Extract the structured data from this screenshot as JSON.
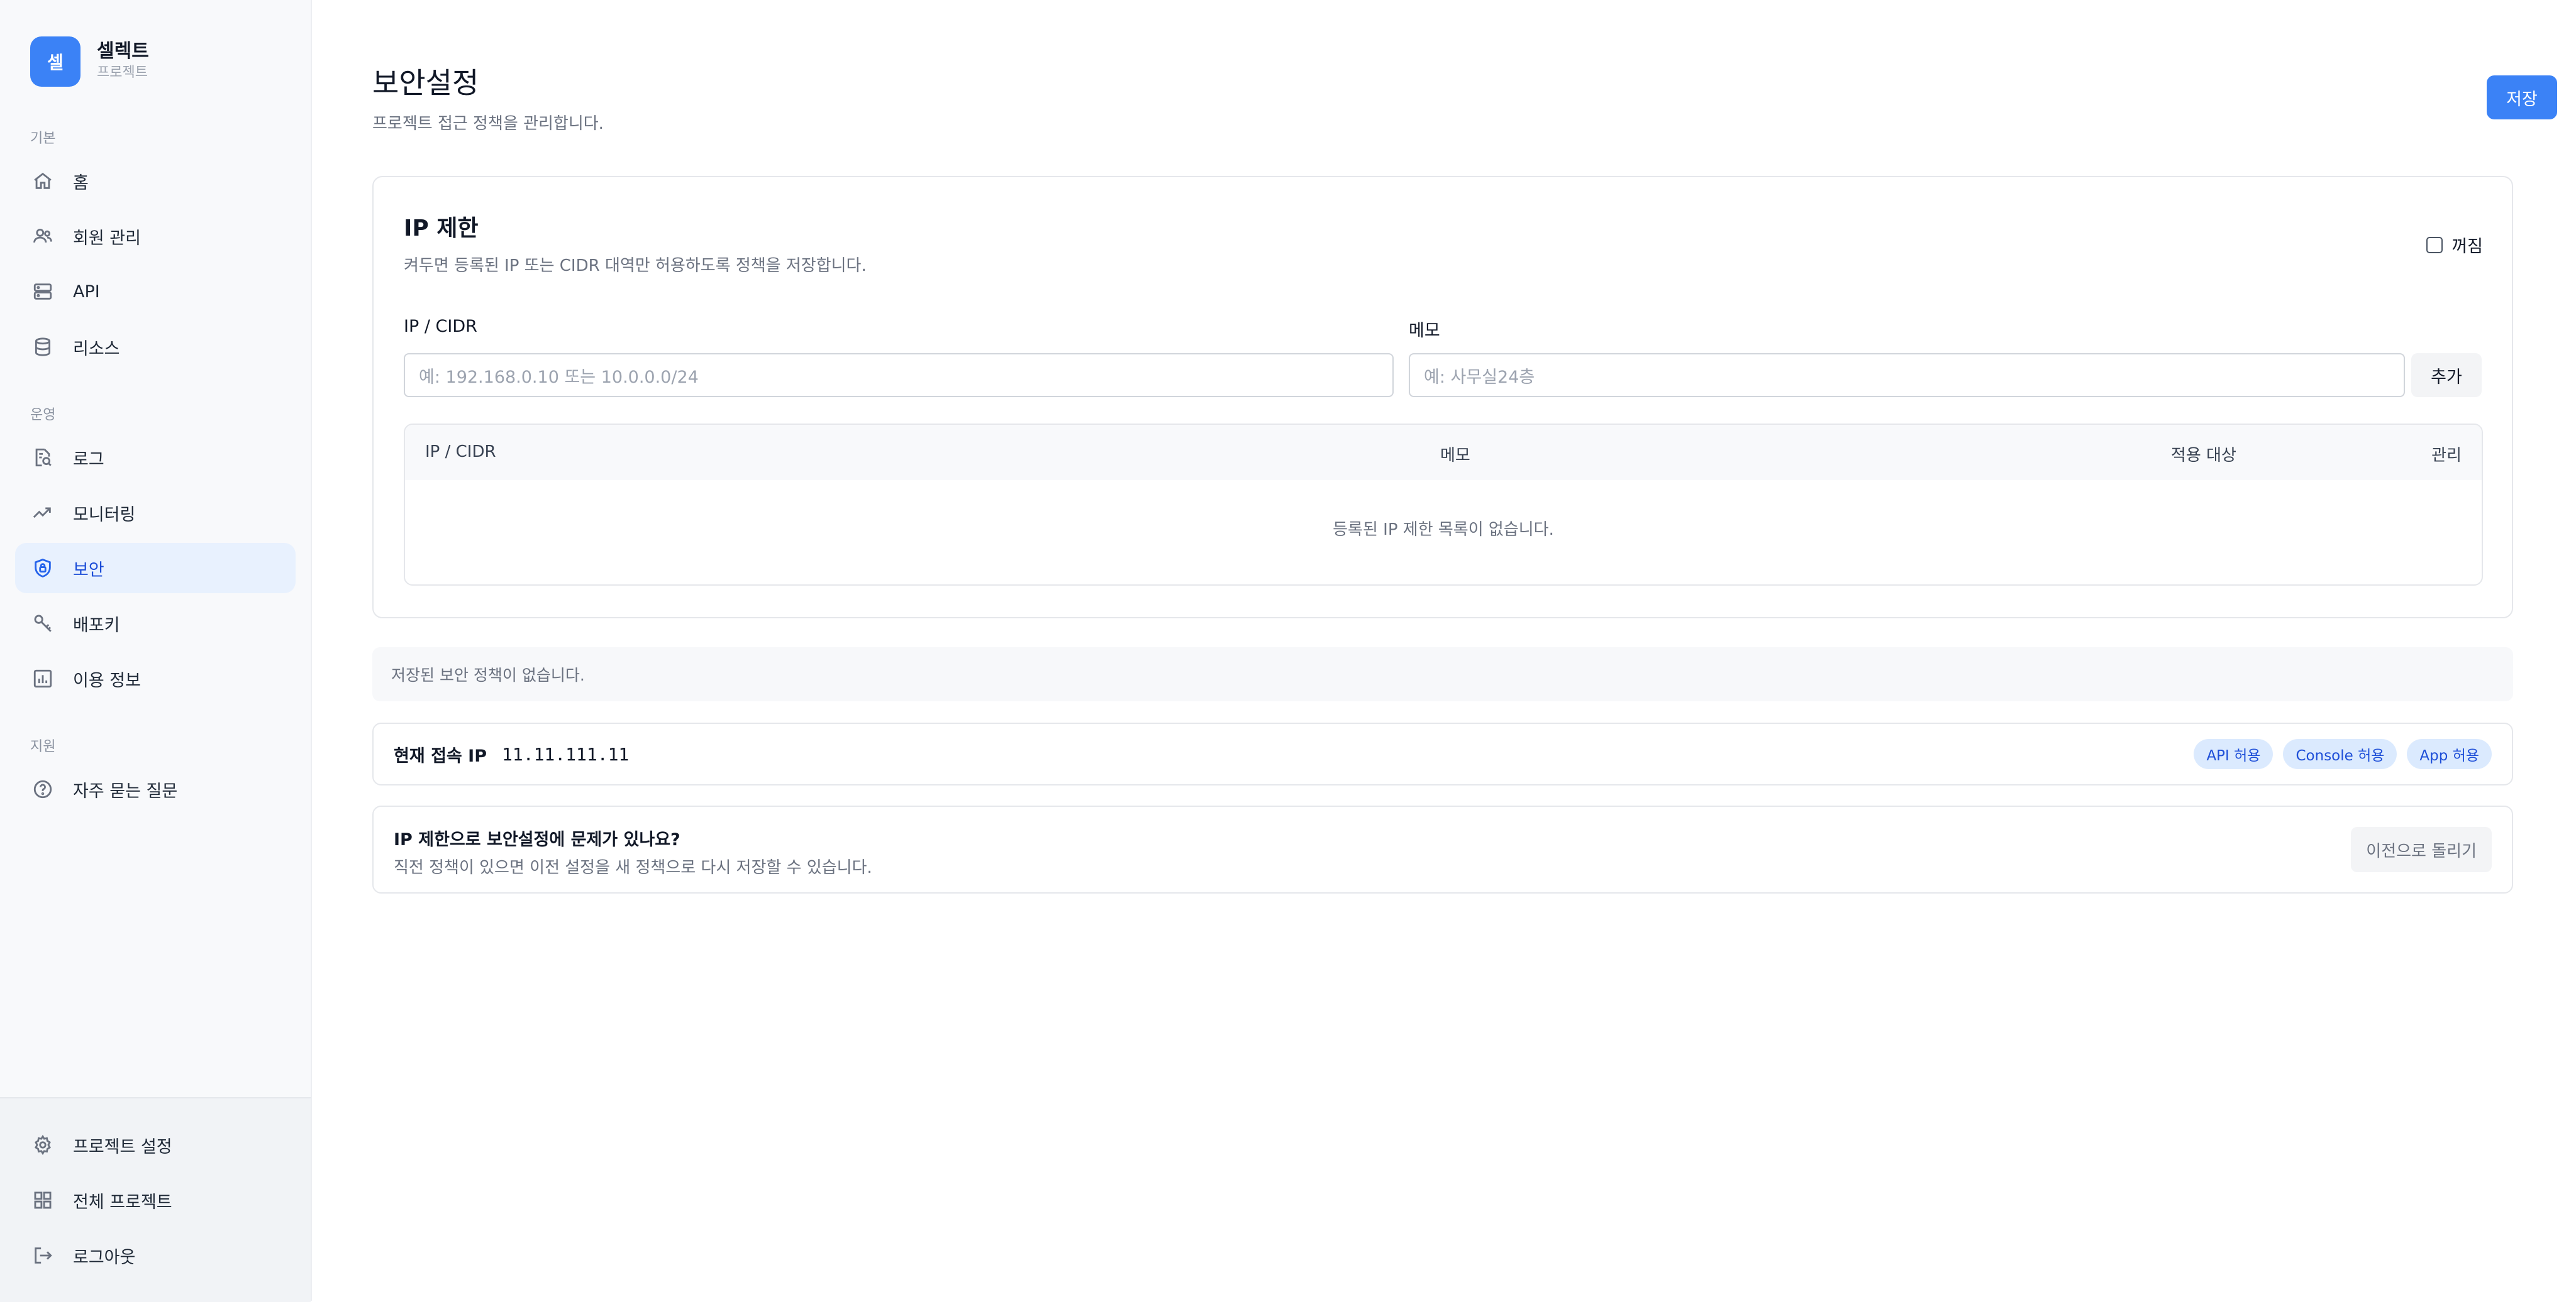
{
  "brand": {
    "logo_char": "셀",
    "name": "셀렉트",
    "subtitle": "프로젝트"
  },
  "sidebar": {
    "sections": [
      {
        "label": "기본",
        "items": [
          {
            "label": "홈",
            "icon": "home-icon"
          },
          {
            "label": "회원 관리",
            "icon": "users-icon"
          },
          {
            "label": "API",
            "icon": "server-icon"
          },
          {
            "label": "리소스",
            "icon": "database-icon"
          }
        ]
      },
      {
        "label": "운영",
        "items": [
          {
            "label": "로그",
            "icon": "log-search-icon"
          },
          {
            "label": "모니터링",
            "icon": "trend-icon"
          },
          {
            "label": "보안",
            "icon": "shield-lock-icon",
            "active": true
          },
          {
            "label": "배포키",
            "icon": "key-icon"
          },
          {
            "label": "이용 정보",
            "icon": "bar-chart-icon"
          }
        ]
      },
      {
        "label": "지원",
        "items": [
          {
            "label": "자주 묻는 질문",
            "icon": "help-circle-icon"
          }
        ]
      }
    ],
    "bottom": [
      {
        "label": "프로젝트 설정",
        "icon": "gear-icon"
      },
      {
        "label": "전체 프로젝트",
        "icon": "grid-icon"
      },
      {
        "label": "로그아웃",
        "icon": "logout-icon"
      }
    ]
  },
  "page": {
    "title": "보안설정",
    "subtitle": "프로젝트 접근 정책을 관리합니다.",
    "save_label": "저장"
  },
  "ip_restriction": {
    "title": "IP 제한",
    "description": "켜두면 등록된 IP 또는 CIDR 대역만 허용하도록 정책을 저장합니다.",
    "toggle_label": "꺼짐",
    "toggle_checked": false,
    "ip_field_label": "IP / CIDR",
    "ip_placeholder": "예: 192.168.0.10 또는 10.0.0.0/24",
    "memo_field_label": "메모",
    "memo_placeholder": "예: 사무실24층",
    "add_label": "추가",
    "table": {
      "columns": [
        "IP / CIDR",
        "메모",
        "적용 대상",
        "관리"
      ],
      "rows": [],
      "empty_text": "등록된 IP 제한 목록이 없습니다."
    }
  },
  "notice": "저장된 보안 정책이 없습니다.",
  "current_ip": {
    "label": "현재 접속 IP",
    "value": "11.11.111.11",
    "badges": [
      "API 허용",
      "Console 허용",
      "App 허용"
    ]
  },
  "help": {
    "title": "IP 제한으로 보안설정에 문제가 있나요?",
    "description": "직전 정책이 있으면 이전 설정을 새 정책으로 다시 저장할 수 있습니다.",
    "button_label": "이전으로 돌리기"
  },
  "colors": {
    "accent": "#3b82f6",
    "active_bg": "#e8f1fe",
    "badge_bg": "#dbeafe",
    "badge_text": "#1d4ed8"
  }
}
